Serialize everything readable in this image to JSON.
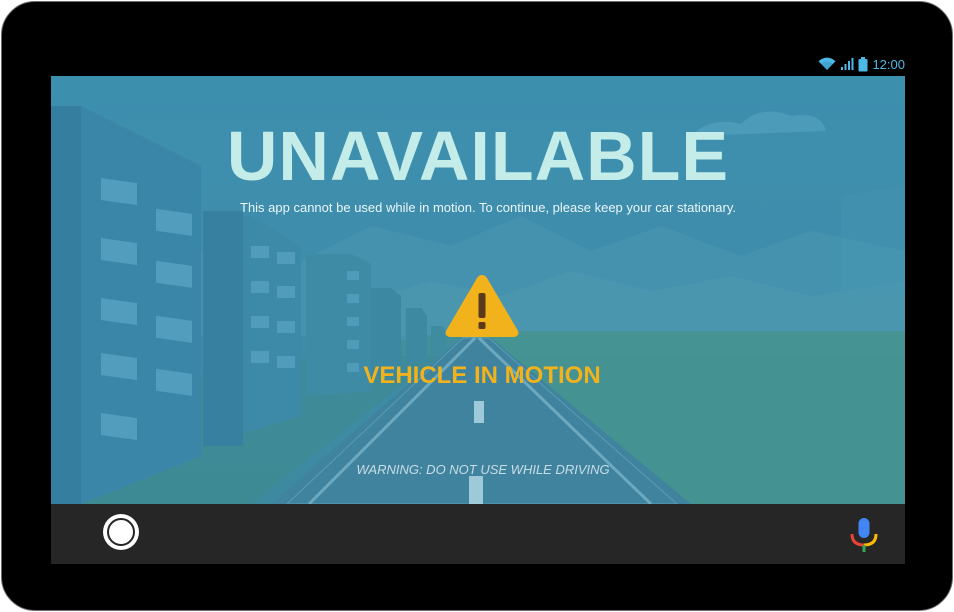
{
  "status_bar": {
    "time": "12:00",
    "icons": [
      "wifi-icon",
      "signal-icon",
      "battery-icon"
    ]
  },
  "main": {
    "title": "UNAVAILABLE",
    "subtitle": "This app cannot be used while in motion. To continue, please keep your car stationary.",
    "alert_icon": "warning-triangle-icon",
    "status": "VEHICLE IN MOTION",
    "warning": "WARNING: DO NOT USE WHILE DRIVING"
  },
  "nav_bar": {
    "home_icon": "home-circle-icon",
    "voice_icon": "microphone-icon"
  },
  "colors": {
    "accent": "#f2b21c",
    "title": "#c4ece8",
    "screen_bg": "#3d8fae",
    "nav_bg": "#262626",
    "status_icons": "#4db8e6"
  }
}
